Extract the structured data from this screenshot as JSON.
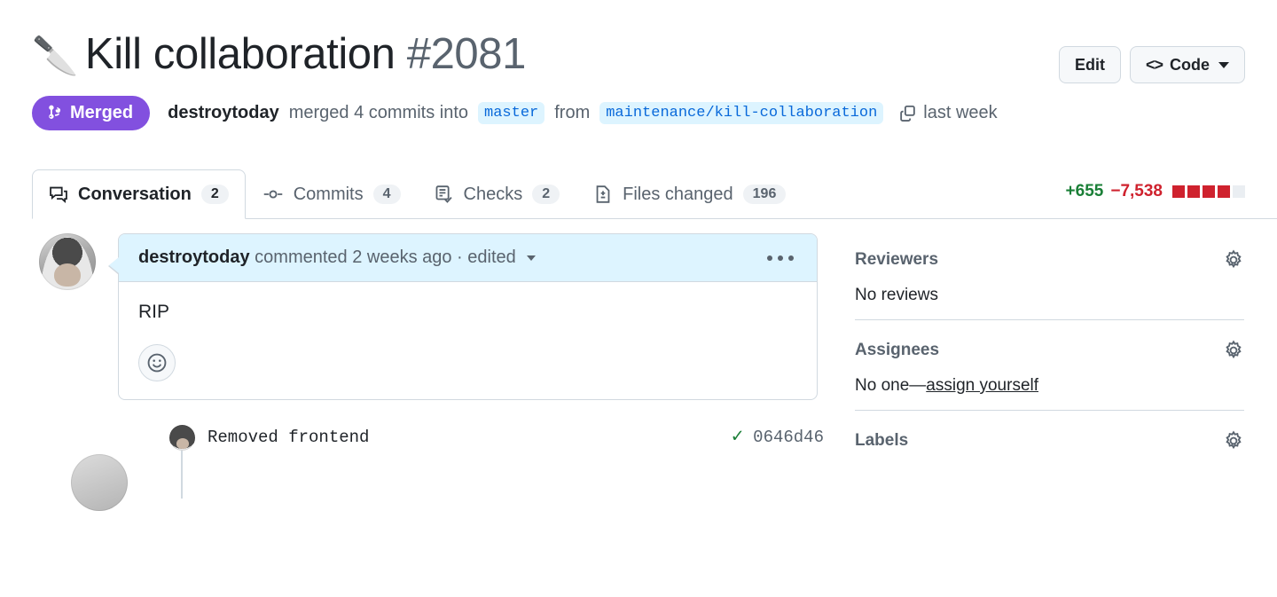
{
  "header": {
    "emoji": "🔪",
    "title": "Kill collaboration",
    "number": "#2081",
    "edit_label": "Edit",
    "code_label": "Code"
  },
  "status": {
    "badge": "Merged",
    "actor": "destroytoday",
    "verb": "merged 4 commits into",
    "base_branch": "master",
    "from_word": "from",
    "head_branch": "maintenance/kill-collaboration",
    "time": "last week"
  },
  "tabs": [
    {
      "label": "Conversation",
      "count": "2",
      "icon": "comment-discussion-icon",
      "active": true
    },
    {
      "label": "Commits",
      "count": "4",
      "icon": "git-commit-icon",
      "active": false
    },
    {
      "label": "Checks",
      "count": "2",
      "icon": "checklist-icon",
      "active": false
    },
    {
      "label": "Files changed",
      "count": "196",
      "icon": "file-diff-icon",
      "active": false
    }
  ],
  "diffstat": {
    "additions": "+655",
    "deletions": "−7,538",
    "blocks": [
      "on",
      "on",
      "on",
      "on",
      "off"
    ],
    "add_color": "#1a7f37",
    "del_color": "#cf222e"
  },
  "comment": {
    "author": "destroytoday",
    "meta": "commented 2 weeks ago · edited",
    "body": "RIP",
    "header_bg": "#ddf4ff"
  },
  "commit": {
    "message": "Removed frontend",
    "sha": "0646d46",
    "status_check": "✓"
  },
  "sidebar": [
    {
      "title": "Reviewers",
      "value": "No reviews",
      "link": ""
    },
    {
      "title": "Assignees",
      "value": "No one—",
      "link": "assign yourself"
    },
    {
      "title": "Labels",
      "value": "",
      "link": ""
    }
  ]
}
